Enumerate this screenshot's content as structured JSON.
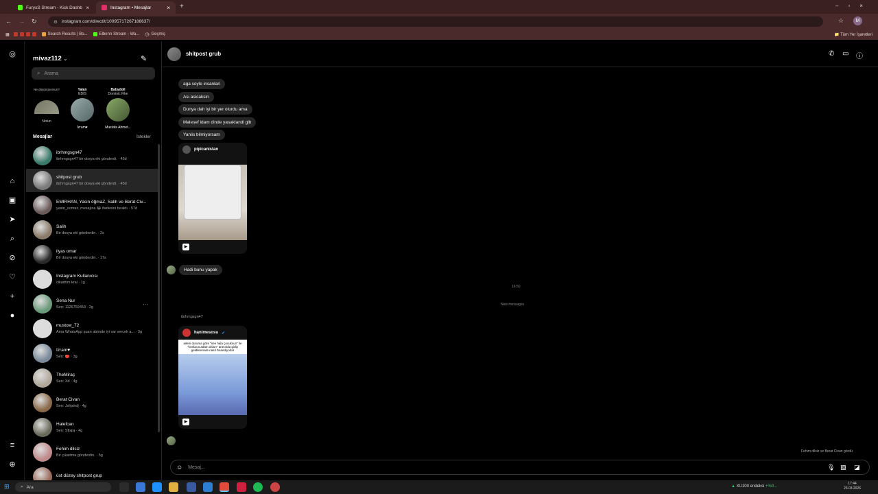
{
  "browser": {
    "tabs": [
      {
        "label": "FurysS Stream - Kick Dashboard",
        "color": "#53fc18"
      },
      {
        "label": "Instagram • Mesajlar",
        "color": "#e1306c"
      }
    ],
    "url": "instagram.com/direct/t/100957172671886​37/",
    "bookmarks": [
      "Search Results | Bo...",
      "Elbenn Stream - Wa...",
      "Geçmiş"
    ],
    "bookmarks_right": "Tüm Yer İşaretleri"
  },
  "inbox": {
    "username": "mivaz112",
    "search_placeholder": "Arama",
    "stories": [
      {
        "note": "Ne düşünüyorsun?",
        "label": "Notun"
      },
      {
        "note": "Yalan",
        "sub": "EDIS",
        "label": "İzram♥"
      },
      {
        "note": "Babydoll",
        "sub": "Dominic Fike",
        "label": "Mustafa Ahmet..."
      }
    ],
    "section_title": "Mesajlar",
    "requests_label": "İstekler",
    "threads": [
      {
        "name": "ibrhmgsgn47",
        "preview": "ibrhmgsgn47 bir dosya eki gönderdi. · 45d",
        "color": "#3a7a6a"
      },
      {
        "name": "shitpost grub",
        "preview": "ibrhmgsgn47 bir dosya eki gönderdi. · 45d",
        "color": "#7a7a7a"
      },
      {
        "name": "EMİRHAN, Yasin öğmaZ, Salih ve Berat Civ...",
        "preview": "yasin_ocmaz, mesajına 😂 ifadesini bıraktı · 57d",
        "color": "#6a5a5a"
      },
      {
        "name": "Salih",
        "preview": "Bir dosya eki gönderdin. · 2s",
        "color": "#8a7a6a"
      },
      {
        "name": "ilyas omar",
        "preview": "Bir dosya eki gönderdin. · 17s",
        "color": "#2a2a2a"
      },
      {
        "name": "Instagram Kullanıcısı",
        "preview": "cikarttim kral · 1g",
        "color": "#dcdcdc"
      },
      {
        "name": "Sena Nur",
        "preview": "Sen: 1126759453 · 2g",
        "color": "#6a9a7a"
      },
      {
        "name": "mustow_72",
        "preview": "Ama WhatsApp şuan abimde iyi var vercek a... · 3g",
        "color": "#dcdcdc"
      },
      {
        "name": "İzram♥",
        "preview": "Sen: 🔴 · 3g",
        "color": "#7a8a9a"
      },
      {
        "name": "TheMiraç",
        "preview": "Sen: Xd · 4g",
        "color": "#b0a89a"
      },
      {
        "name": "Berat Civan",
        "preview": "Sen: Jshjshdj · 4g",
        "color": "#8a6a4a"
      },
      {
        "name": "Halefcan",
        "preview": "Sen: Sfjsjsj · 4g",
        "color": "#6a6a5a"
      },
      {
        "name": "Fehim dilsiz",
        "preview": "Bir çıkartma gönderdin. · 5g",
        "color": "#c08a8a"
      },
      {
        "name": "üst düzey shitpost grup",
        "preview": "",
        "color": "#9a6a5a"
      }
    ]
  },
  "conversation": {
    "title": "shitpost grub",
    "messages": [
      "aga soyle insanlari",
      "Asi asicaksin",
      "Dunya dah iyi bir yer olurdu ama",
      "Malesef idam dinde yasaklandi glb",
      "Yanlis bilmiyorsam"
    ],
    "post1_author": "pipicanistan",
    "reply": "Hadi bunu yapak",
    "time": "16:50",
    "new_messages": "New messages",
    "sender2": "ibrhmgsgn47",
    "post2_author": "hanimesosu",
    "post2_caption": "ailem duruma göre \"sen hala çocuksun\" ile \"koskoca adam oldun\" arasında gidip geldiklerinde nasıl hissediyorlar",
    "seen_by": "Fehim dilsiz ve Berat Civan gördü",
    "composer_placeholder": "Mesaj..."
  },
  "taskbar": {
    "search": "Ara",
    "ticker": "XU100 endeksi",
    "ticker_change": "+%0...",
    "time": "17:44",
    "date": "23.03.2026"
  }
}
